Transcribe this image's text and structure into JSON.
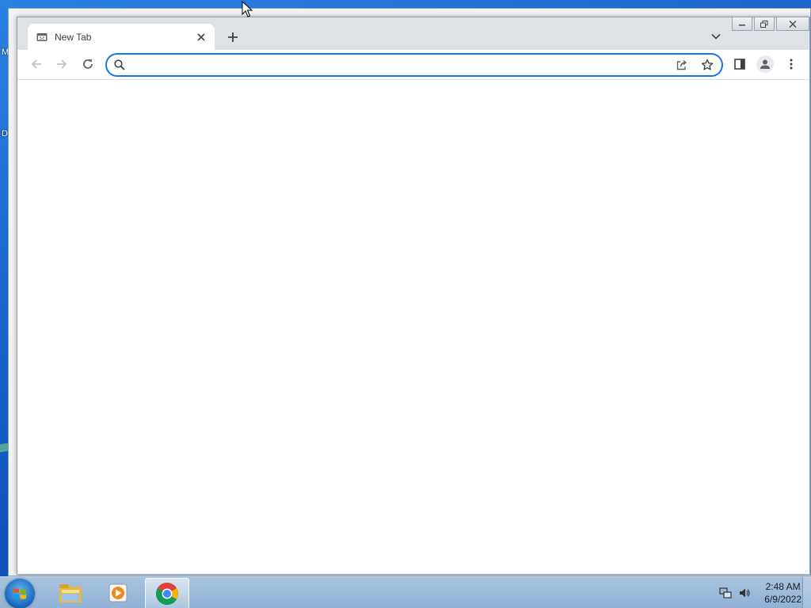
{
  "desktop": {
    "labels": [
      "M",
      "D"
    ]
  },
  "browser": {
    "tab": {
      "title": "New Tab",
      "favicon": "new-tab-icon"
    },
    "omnibox": {
      "value": "",
      "placeholder": ""
    },
    "accent_color": "#1a73e8"
  },
  "taskbar": {
    "apps": [
      "windows-explorer-icon",
      "media-player-icon",
      "chrome-icon"
    ],
    "clock": {
      "time": "2:48 AM",
      "date": "6/9/2022"
    }
  }
}
